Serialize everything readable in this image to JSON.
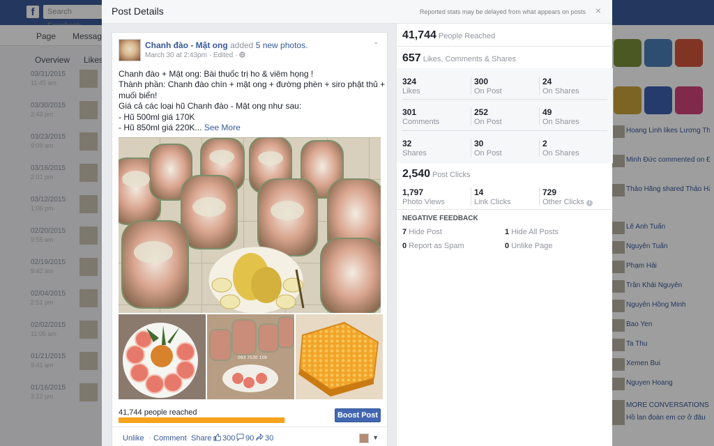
{
  "background": {
    "search_placeholder": "Search Facebook",
    "nav": [
      "Page",
      "Messages"
    ],
    "subtabs": [
      "Overview",
      "Likes"
    ],
    "rows": [
      {
        "date": "03/31/2015",
        "time": "11:45 am"
      },
      {
        "date": "03/30/2015",
        "time": "2:43 pm"
      },
      {
        "date": "03/23/2015",
        "time": "9:09 am"
      },
      {
        "date": "03/16/2015",
        "time": "2:01 pm"
      },
      {
        "date": "03/12/2015",
        "time": "1:06 pm"
      },
      {
        "date": "02/20/2015",
        "time": "9:55 am"
      },
      {
        "date": "02/19/2015",
        "time": "9:42 am"
      },
      {
        "date": "02/04/2015",
        "time": "2:51 pm"
      },
      {
        "date": "02/02/2015",
        "time": "11:05 am"
      },
      {
        "date": "01/21/2015",
        "time": "9:41 am"
      },
      {
        "date": "01/16/2015",
        "time": "3:12 pm"
      }
    ],
    "feed": [
      "Hoang Linh likes Lương Thương's post.",
      "Minh Đức commented on Đức Gia's post.",
      "Thảo Hằng shared Thảo Hằng Shop's album in the group: Bán hàng online.",
      "Lê Anh Tuấn",
      "Nguyễn Tuấn",
      "Phạm Hải",
      "Trần Khải Nguyên",
      "Nguyễn Hồng Minh",
      "Bao Yen",
      "Ta Thu",
      "Xemen Bui",
      "Nguyen Hoang",
      "MORE CONVERSATIONS",
      "Hồ lan đoàn em cơ ở đâu"
    ]
  },
  "modal": {
    "title": "Post Details",
    "note": "Reported stats may be delayed from what appears on posts",
    "close_label": "×"
  },
  "post": {
    "author": "Chanh đào - Mật ong",
    "verb": " added ",
    "photos_link": "5 new photos.",
    "timestamp": "March 30 at 2:43pm",
    "edited": "Edited",
    "lines": [
      "Chanh đào + Mật ong: Bài thuốc trị ho & viêm họng !",
      "Thành phần: Chanh đào chín + mật ong + đường phèn + siro phật thủ +",
      "muối biển!",
      "Giá cả các loại hũ Chanh đào - Mật ong như sau:",
      "- Hũ 500ml giá 170K"
    ],
    "last_line": "- Hũ 850ml giá 220K...",
    "see_more": "See More",
    "watermark": "093 7530 109",
    "reach_text": "41,744 people reached",
    "reach_fraction": 0.99,
    "boost_label": "Boost Post",
    "actions": {
      "unlike": "Unlike",
      "comment": "Comment",
      "share": "Share",
      "likes": "300",
      "comments": "90",
      "shares": "30"
    }
  },
  "stats": {
    "reached": {
      "value": "41,744",
      "label": "People Reached"
    },
    "engagement": {
      "value": "657",
      "label": "Likes, Comments & Shares"
    },
    "grid": [
      [
        {
          "n": "324",
          "l": "Likes"
        },
        {
          "n": "300",
          "l": "On Post"
        },
        {
          "n": "24",
          "l": "On Shares"
        }
      ],
      [
        {
          "n": "301",
          "l": "Comments"
        },
        {
          "n": "252",
          "l": "On Post"
        },
        {
          "n": "49",
          "l": "On Shares"
        }
      ],
      [
        {
          "n": "32",
          "l": "Shares"
        },
        {
          "n": "30",
          "l": "On Post"
        },
        {
          "n": "2",
          "l": "On Shares"
        }
      ]
    ],
    "clicks": {
      "value": "2,540",
      "label": "Post Clicks"
    },
    "click_breakdown": [
      {
        "n": "1,797",
        "l": "Photo Views"
      },
      {
        "n": "14",
        "l": "Link Clicks"
      },
      {
        "n": "729",
        "l": "Other Clicks"
      }
    ],
    "negative_title": "NEGATIVE FEEDBACK",
    "negative": [
      {
        "n": "7",
        "l": "Hide Post"
      },
      {
        "n": "1",
        "l": "Hide All Posts"
      },
      {
        "n": "0",
        "l": "Report as Spam"
      },
      {
        "n": "0",
        "l": "Unlike Page"
      }
    ]
  },
  "colors": {
    "brand": "#3b5998",
    "link": "#365899",
    "boost": "#4267b2",
    "reach_bar": "#f7a21b"
  }
}
